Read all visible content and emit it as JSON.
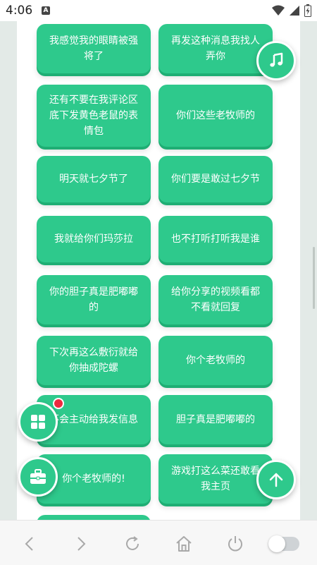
{
  "status_bar": {
    "time": "4:06",
    "app_indicator": "A",
    "icons": [
      "wifi-icon",
      "signal-icon",
      "battery-charging-icon"
    ]
  },
  "phrases": [
    "我感觉我的眼睛被强将了",
    "再发这种消息我找人弄你",
    "还有不要在我评论区底下发黄色老鼠的表情包",
    "你们这些老牧师的",
    "明天就七夕节了",
    "你们要是敢过七夕节",
    "我就给你们玛莎拉",
    "也不打听打听我是谁",
    "你的胆子真是肥嘟嘟的",
    "给你分享的视频看都不看就回复",
    "下次再这么敷衍就给你抽成陀螺",
    "你个老牧师的",
    "不会主动给我发信息",
    "胆子真是肥嘟嘟的",
    "你个老牧师的!",
    "游戏打这么菜还敢看我主页"
  ],
  "fabs": {
    "music": "music-note-icon",
    "grid": "grid-icon",
    "toolbox": "toolbox-icon",
    "back_to_top": "arrow-up-icon"
  },
  "bottom_nav": [
    "back-icon",
    "forward-icon",
    "refresh-icon",
    "home-icon",
    "power-icon"
  ],
  "colors": {
    "accent": "#2ec98c",
    "accent_shadow": "#1fae74",
    "badge": "#ee2a3f",
    "page_bg": "#e3eae7"
  }
}
